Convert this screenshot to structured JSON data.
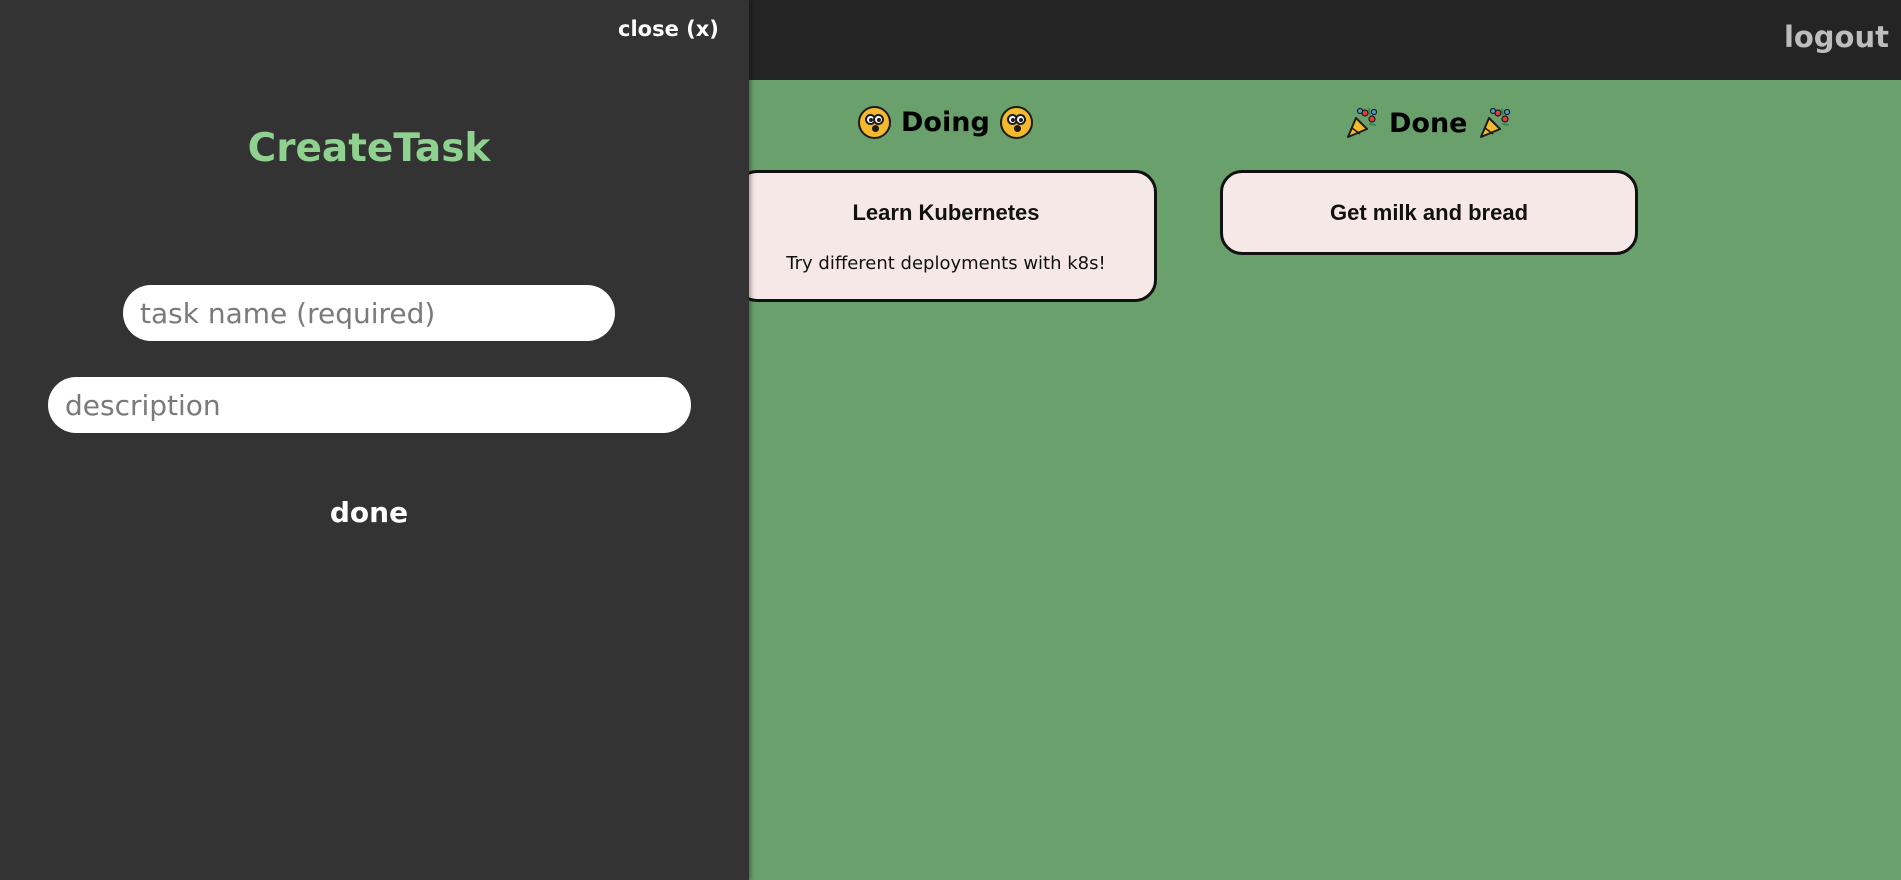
{
  "header": {
    "logout_label": "logout"
  },
  "board": {
    "columns": [
      {
        "title": "Doing",
        "icon": "dizzy-face-icon",
        "cards": [
          {
            "title": "Learn Kubernetes",
            "description": "Try different deployments with k8s!"
          }
        ]
      },
      {
        "title": "Done",
        "icon": "party-popper-icon",
        "cards": [
          {
            "title": "Get milk and bread"
          }
        ]
      }
    ]
  },
  "drawer": {
    "close_label": "close (x)",
    "title": "CreateTask",
    "task_name": {
      "value": "",
      "placeholder": "task name (required)"
    },
    "description": {
      "value": "",
      "placeholder": "description"
    },
    "done_label": "done"
  },
  "colors": {
    "board_background": "#6aa06b",
    "topbar": "#242424",
    "drawer": "#333333",
    "title_accent": "#8fd18f",
    "card_background": "#f6e8e7"
  }
}
